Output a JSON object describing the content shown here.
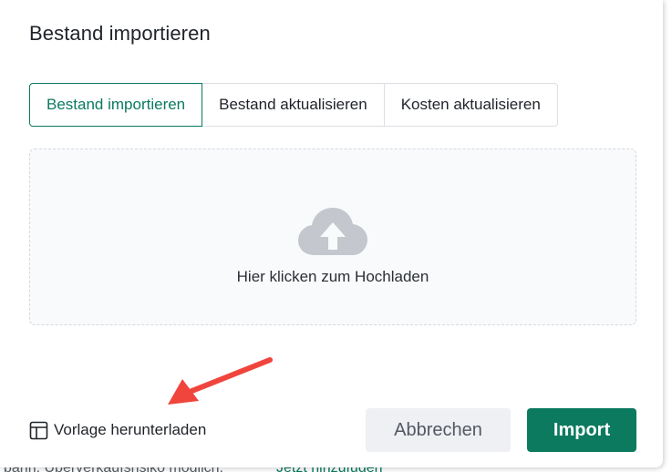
{
  "dialog": {
    "title": "Bestand importieren",
    "tabs": [
      {
        "label": "Bestand importieren",
        "active": true
      },
      {
        "label": "Bestand aktualisieren",
        "active": false
      },
      {
        "label": "Kosten aktualisieren",
        "active": false
      }
    ],
    "upload": {
      "label": "Hier klicken zum Hochladen",
      "icon": "cloud-upload-icon"
    },
    "download_template_label": "Vorlage herunterladen",
    "cancel_label": "Abbrechen",
    "import_label": "Import"
  },
  "background": {
    "text": "bann. Überverkaufsrisiko möglich.",
    "link": "Jetzt hinzufügen"
  },
  "colors": {
    "accent": "#0b7a5f",
    "annotation_arrow": "#f0453c",
    "upload_icon": "#c4c8ce"
  }
}
